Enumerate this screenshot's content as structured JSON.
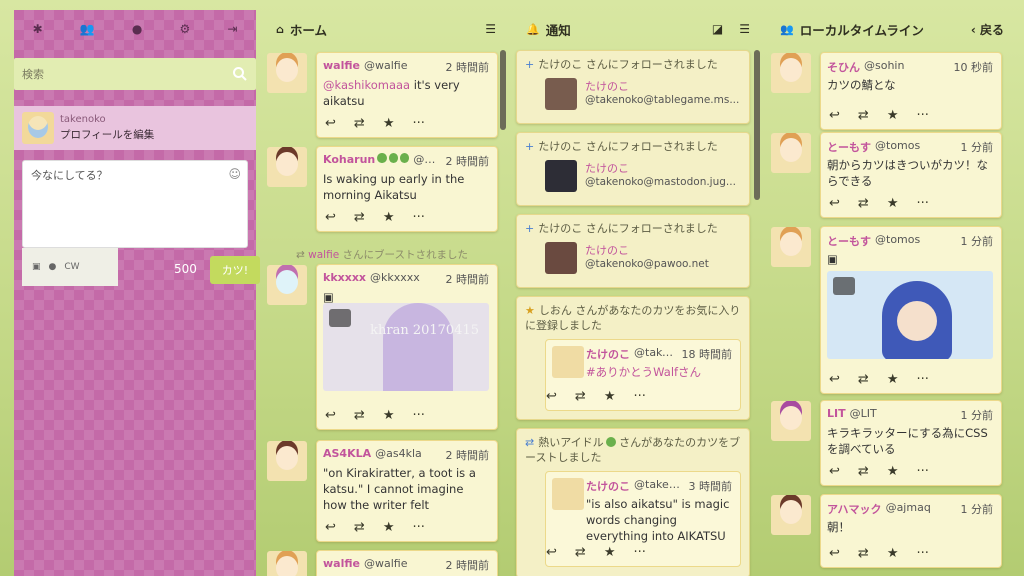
{
  "drawer": {
    "nav_icons": [
      "asterisk-icon",
      "users-icon",
      "globe-icon",
      "gear-icon",
      "signout-icon"
    ],
    "search_placeholder": "検索",
    "account_name": "takenoko",
    "edit_profile": "プロフィールを編集",
    "compose_placeholder": "今なにしてる？",
    "cw_label": "CW",
    "char_count": "500",
    "toot_button": "カツ!"
  },
  "home": {
    "title": "ホーム",
    "statuses": [
      {
        "display_name": "walfie",
        "acct": "@walfie",
        "time": "2 時間前",
        "mention": "@kashikomaaa",
        "text": " it's very aikatsu"
      },
      {
        "display_name": "Koharun",
        "acct": "@k...",
        "time": "2 時間前",
        "text": "Is waking up early in the morning Aikatsu"
      },
      {
        "boost_by": "walfie",
        "boost_suffix": " さんにブーストされました"
      },
      {
        "display_name": "kkxxxx",
        "acct": "@kkxxxx",
        "time": "2 時間前",
        "text": "",
        "media_text": "khran 20170415"
      },
      {
        "display_name": "AS4KLA",
        "acct": "@as4kla",
        "time": "2 時間前",
        "text": "\"on Kirakiratter, a toot is a katsu.\"  I cannot imagine how the writer felt"
      },
      {
        "display_name": "walfie",
        "acct": "@walfie",
        "time": "2 時間前",
        "text": ""
      }
    ]
  },
  "notifications": {
    "title": "通知",
    "items": [
      {
        "text": "たけのこ さんにフォローされました",
        "name": "たけのこ",
        "acct": "@takenoko@tablegame.ms..."
      },
      {
        "text": "たけのこ さんにフォローされました",
        "name": "たけのこ",
        "acct": "@takenoko@mastodon.jug..."
      },
      {
        "text": "たけのこ さんにフォローされました",
        "name": "たけのこ",
        "acct": "@takenoko@pawoo.net"
      },
      {
        "text": "しおん さんがあなたのカツをお気に入りに登録しました",
        "status_name": "たけのこ",
        "status_acct": "@take...",
        "status_time": "18 時間前",
        "status_text": "#ありかとうWalfさん"
      },
      {
        "text_prefix": "熱いアイドル",
        "text_suffix": " さんがあなたのカツをブーストしました",
        "status_name": "たけのこ",
        "status_acct": "@taken...",
        "status_time": "3 時間前",
        "status_text": "\"is also aikatsu\" is magic words changing everything into AIKATSU"
      }
    ]
  },
  "local": {
    "title": "ローカルタイムライン",
    "back": "戻る",
    "statuses": [
      {
        "display_name": "そひん",
        "acct": "@sohin",
        "time": "10 秒前",
        "text": "カツの鯖とな"
      },
      {
        "display_name": "とーもす",
        "acct": "@tomos",
        "time": "1 分前",
        "text": "朝からカツはきついがカツ！ならできる"
      },
      {
        "display_name": "とーもす",
        "acct": "@tomos",
        "time": "1 分前",
        "text": ""
      },
      {
        "display_name": "LIT",
        "acct": "@LIT",
        "time": "1 分前",
        "text": "キラキラッターにする為にCSSを調べている"
      },
      {
        "display_name": "アハマック",
        "acct": "@ajmaq",
        "time": "1 分前",
        "text": "朝！"
      }
    ]
  },
  "colors": {
    "accent": "#c2549c",
    "drawer": "#c46aa8",
    "card": "#f9f6d2",
    "toot_button": "#c3da5e"
  }
}
